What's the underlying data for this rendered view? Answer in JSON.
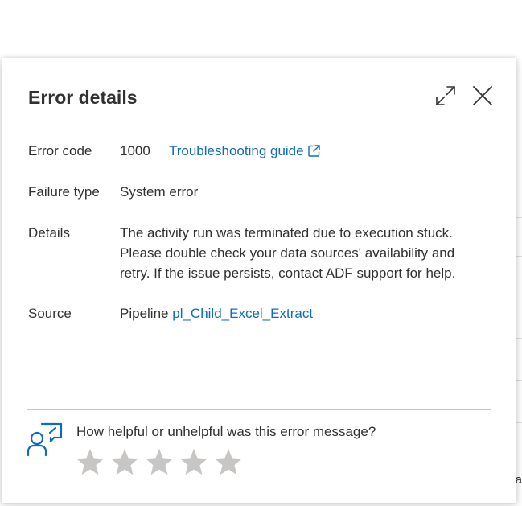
{
  "dialog": {
    "title": "Error details"
  },
  "rows": {
    "error_code": {
      "label": "Error code",
      "value": "1000",
      "link": "Troubleshooting guide"
    },
    "failure_type": {
      "label": "Failure type",
      "value": "System error"
    },
    "details": {
      "label": "Details",
      "line1": "The activity run was terminated due to execution stuck.",
      "line2": "Please double check your data sources' availability and",
      "line3": "retry. If the issue persists, contact ADF support for help."
    },
    "source": {
      "label": "Source",
      "prefix": "Pipeline",
      "link": "pl_Child_Excel_Extract"
    }
  },
  "feedback": {
    "question": "How helpful or unhelpful was this error message?",
    "rating": 0,
    "max_rating": 5
  },
  "background": {
    "edge_char": "a"
  },
  "colors": {
    "link": "#0f6cbd",
    "text": "#323130",
    "star": "#c8c6c4",
    "divider": "#c8c6c4"
  },
  "icons": {
    "expand": "expand-icon",
    "close": "close-icon",
    "external_link": "external-link-icon",
    "feedback": "person-feedback-icon",
    "star": "star-icon"
  }
}
